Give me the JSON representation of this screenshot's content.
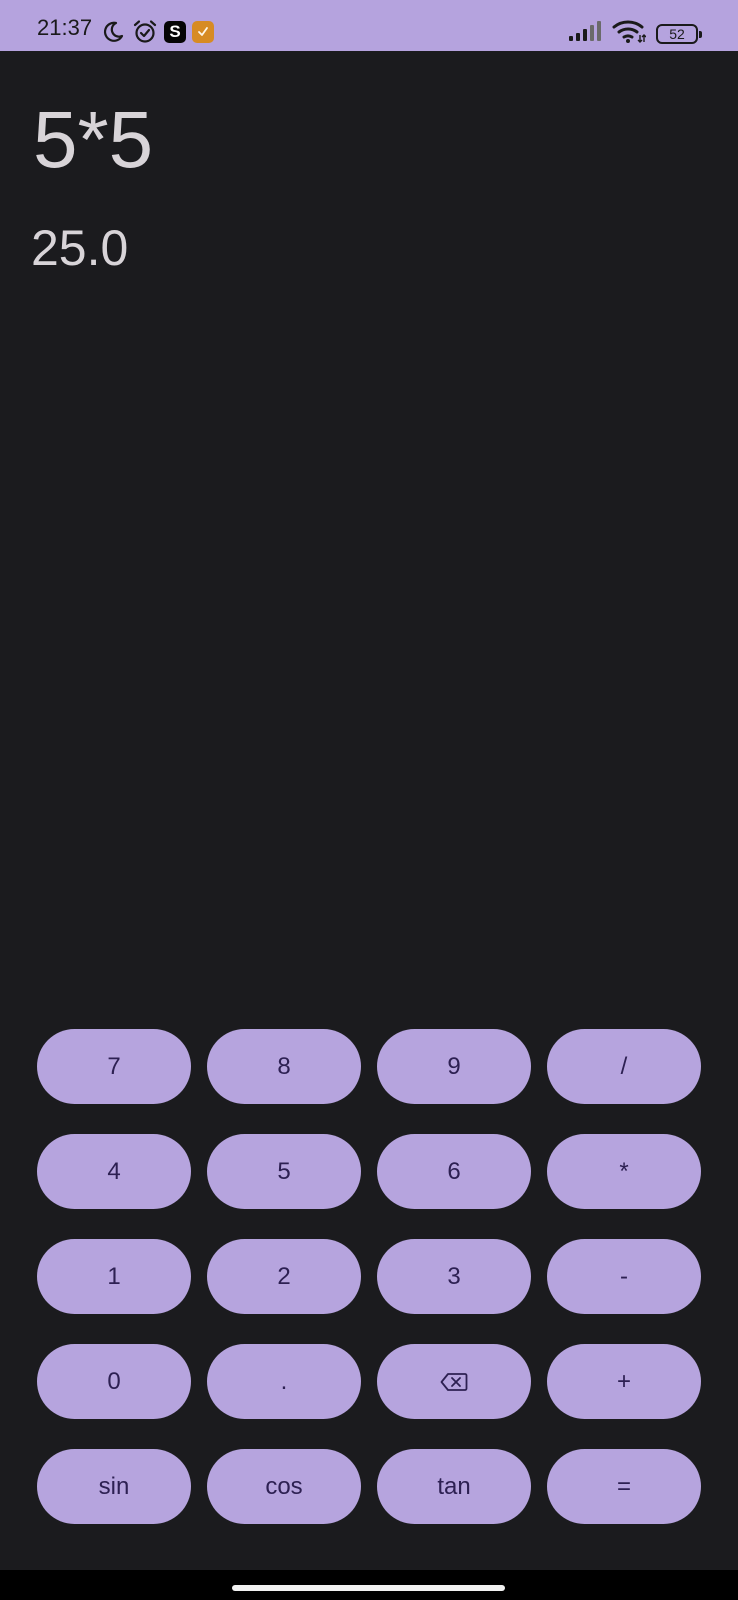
{
  "status_bar": {
    "time": "21:37",
    "battery_level": "52",
    "background_color": "#b5a3de",
    "left_icons": [
      "moon-icon",
      "alarm-icon",
      "s-app-icon",
      "orange-app-icon"
    ],
    "right_icons": [
      "signal-icon",
      "wifi-icon",
      "battery-icon"
    ]
  },
  "display": {
    "expression": "5*5",
    "result": "25.0"
  },
  "keypad": {
    "keys": [
      {
        "label": "7",
        "name": "key-7"
      },
      {
        "label": "8",
        "name": "key-8"
      },
      {
        "label": "9",
        "name": "key-9"
      },
      {
        "label": "/",
        "name": "key-divide"
      },
      {
        "label": "4",
        "name": "key-4"
      },
      {
        "label": "5",
        "name": "key-5"
      },
      {
        "label": "6",
        "name": "key-6"
      },
      {
        "label": "*",
        "name": "key-multiply"
      },
      {
        "label": "1",
        "name": "key-1"
      },
      {
        "label": "2",
        "name": "key-2"
      },
      {
        "label": "3",
        "name": "key-3"
      },
      {
        "label": "-",
        "name": "key-subtract"
      },
      {
        "label": "0",
        "name": "key-0"
      },
      {
        "label": ".",
        "name": "key-decimal"
      },
      {
        "label": "",
        "name": "backspace-button",
        "icon": "backspace-icon"
      },
      {
        "label": "+",
        "name": "key-add"
      },
      {
        "label": "sin",
        "name": "key-sin"
      },
      {
        "label": "cos",
        "name": "key-cos"
      },
      {
        "label": "tan",
        "name": "key-tan"
      },
      {
        "label": "=",
        "name": "key-equals"
      }
    ]
  },
  "colors": {
    "background": "#1b1b1e",
    "key_fill": "#b6a4de",
    "key_text": "#2d2052",
    "display_text": "#d8d4d8"
  }
}
